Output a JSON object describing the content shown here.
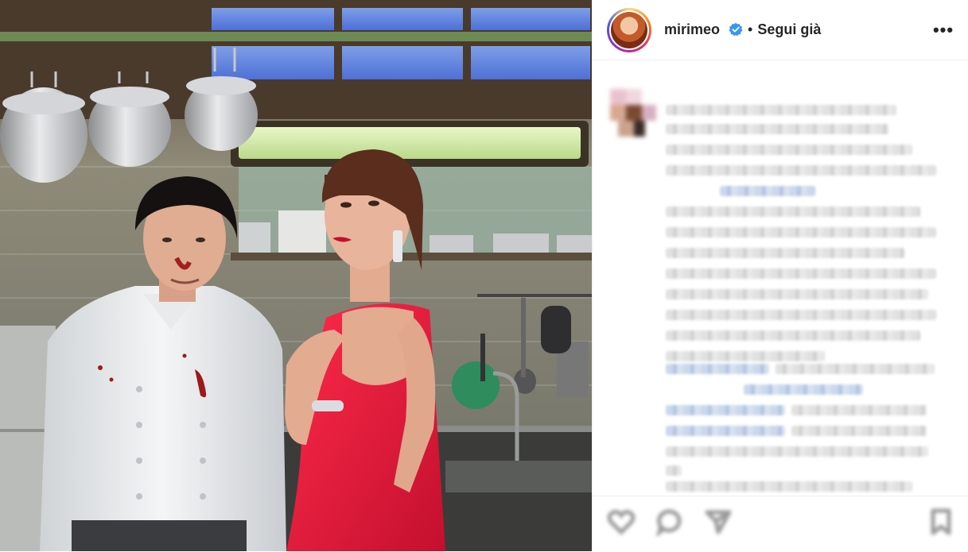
{
  "post": {
    "account": {
      "username": "mirimeo",
      "verified": true,
      "verified_icon": "verified-badge-icon",
      "separator": "•",
      "follow_label": "Segui già",
      "more_label": "•••",
      "ring_colors": [
        "#feda75",
        "#fa7e1e",
        "#d62976",
        "#962fbf",
        "#4f5bd5"
      ],
      "verified_color": "#3897f0"
    },
    "photo": {
      "subject": "post-image"
    },
    "caption_blurred": true,
    "actions": {
      "icons": [
        "heart-icon",
        "comment-icon",
        "share-icon",
        "bookmark-icon"
      ],
      "blurred": true
    }
  }
}
